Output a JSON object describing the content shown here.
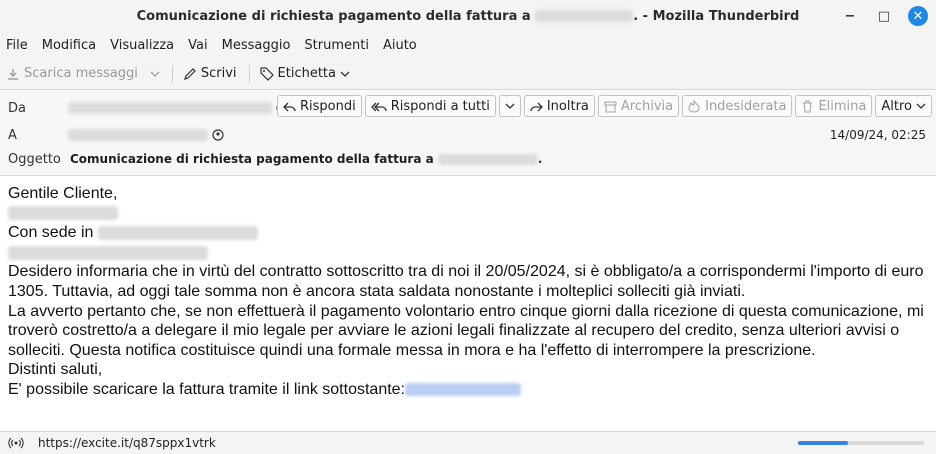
{
  "window": {
    "title_prefix": "Comunicazione di richiesta pagamento della fattura a",
    "title_suffix": ". - Mozilla Thunderbird",
    "controls": [
      "−",
      "□",
      "✕"
    ]
  },
  "menu": [
    "File",
    "Modifica",
    "Visualizza",
    "Vai",
    "Messaggio",
    "Strumenti",
    "Aiuto"
  ],
  "toolbar": {
    "get_messages": "Scarica messaggi",
    "write": "Scrivi",
    "tag": "Etichetta"
  },
  "header": {
    "from_label": "Da",
    "to_label": "A",
    "subject_label": "Oggetto",
    "subject_text": "Comunicazione di richiesta pagamento della fattura a",
    "subject_end": ".",
    "date": "14/09/24, 02:25",
    "buttons": {
      "reply": "Rispondi",
      "reply_all": "Rispondi a tutti",
      "forward": "Inoltra",
      "archive": "Archivia",
      "junk": "Indesiderata",
      "delete": "Elimina",
      "other": "Altro"
    }
  },
  "body": {
    "greeting": "Gentile Cliente,",
    "seat_prefix": "Con sede in",
    "paragraph1": "Desidero informaria che in virtù del contratto sottoscritto tra di noi il 20/05/2024, si è obbligato/a a corrispondermi l'importo di euro 1305. Tuttavia, ad oggi tale somma non è ancora stata saldata nonostante i molteplici solleciti già inviati.",
    "paragraph2": "La avverto pertanto che, se non effettuerà il pagamento volontario entro cinque giorni dalla ricezione di questa comunicazione, mi troverò costretto/a a delegare il mio legale per avviare le azioni legali finalizzate al recupero del credito, senza ulteriori avvisi o solleciti. Questa notifica costituisce quindi una formale messa in mora e ha l'effetto di interrompere la prescrizione.",
    "closing": "Distinti saluti,",
    "link_prefix": "E' possibile scaricare la fattura tramite il link sottostante:"
  },
  "status": {
    "url": "https://excite.it/q87sppx1vtrk",
    "progress": 0.4
  }
}
